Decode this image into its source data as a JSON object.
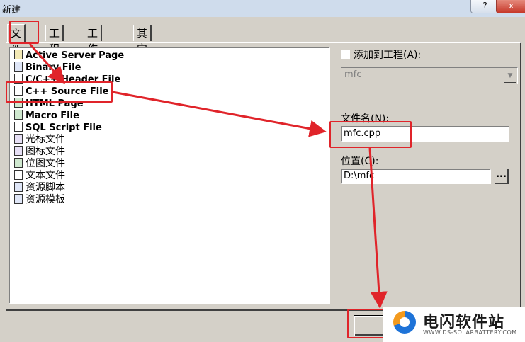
{
  "window": {
    "title": "新建",
    "help_btn": "?",
    "close_btn": "x"
  },
  "tabs": [
    {
      "label": "文件",
      "active": true
    },
    {
      "label": "工程",
      "active": false
    },
    {
      "label": "工作区",
      "active": false
    },
    {
      "label": "其它文档",
      "active": false
    }
  ],
  "file_types": [
    "Active Server Page",
    "Binary File",
    "C/C++ Header File",
    "C++ Source File",
    "HTML Page",
    "Macro File",
    "SQL Script File",
    "光标文件",
    "图标文件",
    "位图文件",
    "文本文件",
    "资源脚本",
    "资源模板"
  ],
  "add_to_project": {
    "label": "添加到工程(A):",
    "checked": false
  },
  "project_combo": {
    "value": "mfc"
  },
  "filename": {
    "label": "文件名(N):",
    "value": "mfc.cpp"
  },
  "location": {
    "label": "位置(C):",
    "value": "D:\\mfc",
    "browse": "..."
  },
  "watermark": {
    "title": "电闪软件站",
    "subtitle": "WWW.DS-SOLARBATTERY.COM"
  },
  "colors": {
    "annotation": "#e0242a",
    "dialog_bg": "#d4d0c8"
  }
}
